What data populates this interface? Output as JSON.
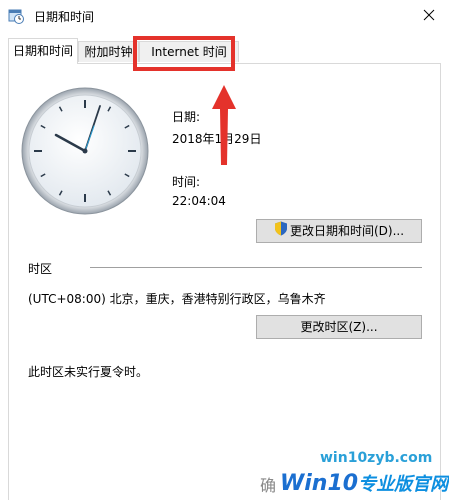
{
  "window": {
    "title": "日期和时间"
  },
  "tabs": [
    {
      "label": "日期和时间"
    },
    {
      "label": "附加时钟"
    },
    {
      "label": "Internet 时间"
    }
  ],
  "main": {
    "date_label": "日期:",
    "date_value": "2018年1月29日",
    "time_label": "时间:",
    "time_value": "22:04:04",
    "change_datetime_button": "更改日期和时间(D)...",
    "timezone_section_label": "时区",
    "timezone_value": "(UTC+08:00) 北京，重庆，香港特别行政区，乌鲁木齐",
    "change_timezone_button": "更改时区(Z)...",
    "dst_text": "此时区未实行夏令时。"
  },
  "footer": {
    "ok_button_partial": "确"
  },
  "watermark": {
    "site": "win10zyb.com",
    "brand": "Win10",
    "brand_rest": "专业版官网"
  },
  "colors": {
    "highlight": "#e4322b",
    "button_bg": "#e1e1e1"
  },
  "icons": {
    "window": "calendar-clock-icon",
    "close": "close-icon",
    "shield": "uac-shield-icon"
  }
}
